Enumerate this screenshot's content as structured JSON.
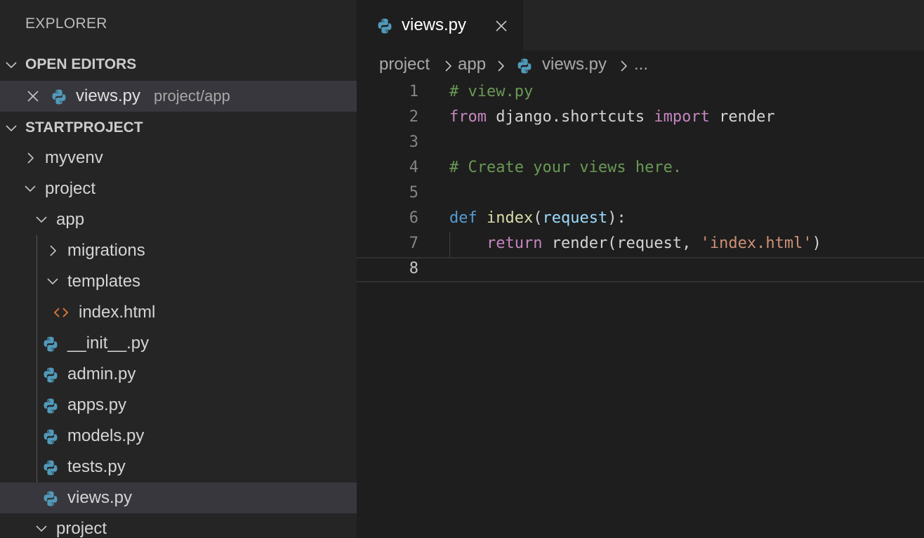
{
  "sidebar": {
    "title": "EXPLORER",
    "open_editors": {
      "header": "OPEN EDITORS",
      "items": [
        {
          "name": "views.py",
          "path": "project/app"
        }
      ]
    },
    "project": {
      "header": "STARTPROJECT",
      "tree": [
        {
          "label": "myvenv"
        },
        {
          "label": "project"
        },
        {
          "label": "app"
        },
        {
          "label": "migrations"
        },
        {
          "label": "templates"
        },
        {
          "label": "index.html"
        },
        {
          "label": "__init__.py"
        },
        {
          "label": "admin.py"
        },
        {
          "label": "apps.py"
        },
        {
          "label": "models.py"
        },
        {
          "label": "tests.py"
        },
        {
          "label": "views.py"
        },
        {
          "label": "project"
        }
      ]
    }
  },
  "editor": {
    "tab": {
      "name": "views.py"
    },
    "breadcrumb": {
      "p1": "project",
      "p2": "app",
      "p3": "views.py",
      "p4": "..."
    },
    "lines": [
      {
        "num": "1",
        "t1": "# view.py"
      },
      {
        "num": "2",
        "t1": "from",
        "t2": " django.shortcuts ",
        "t3": "import",
        "t4": " render"
      },
      {
        "num": "3"
      },
      {
        "num": "4",
        "t1": "# Create your views here."
      },
      {
        "num": "5"
      },
      {
        "num": "6",
        "t1": "def",
        "t2": " ",
        "t3": "index",
        "t4": "(",
        "t5": "request",
        "t6": "):"
      },
      {
        "num": "7",
        "t1": "    ",
        "t2": "return",
        "t3": " render(request, ",
        "t4": "'index.html'",
        "t5": ")"
      },
      {
        "num": "8"
      }
    ]
  },
  "colors": {
    "sidebar_bg": "#252526",
    "editor_bg": "#1e1e1e",
    "selection_bg": "#37373d",
    "python_icon": "#519aba",
    "html_icon": "#e37933",
    "comment": "#6a9955",
    "keyword": "#c586c0",
    "def_keyword": "#569cd6",
    "function": "#dcdcaa",
    "parameter": "#9cdcfe",
    "string": "#ce9178"
  },
  "icons": {
    "python_file": "python-icon",
    "html_file": "html-icon",
    "close": "close-icon",
    "chevron_right": "chevron-right-icon",
    "chevron_down": "chevron-down-icon"
  }
}
